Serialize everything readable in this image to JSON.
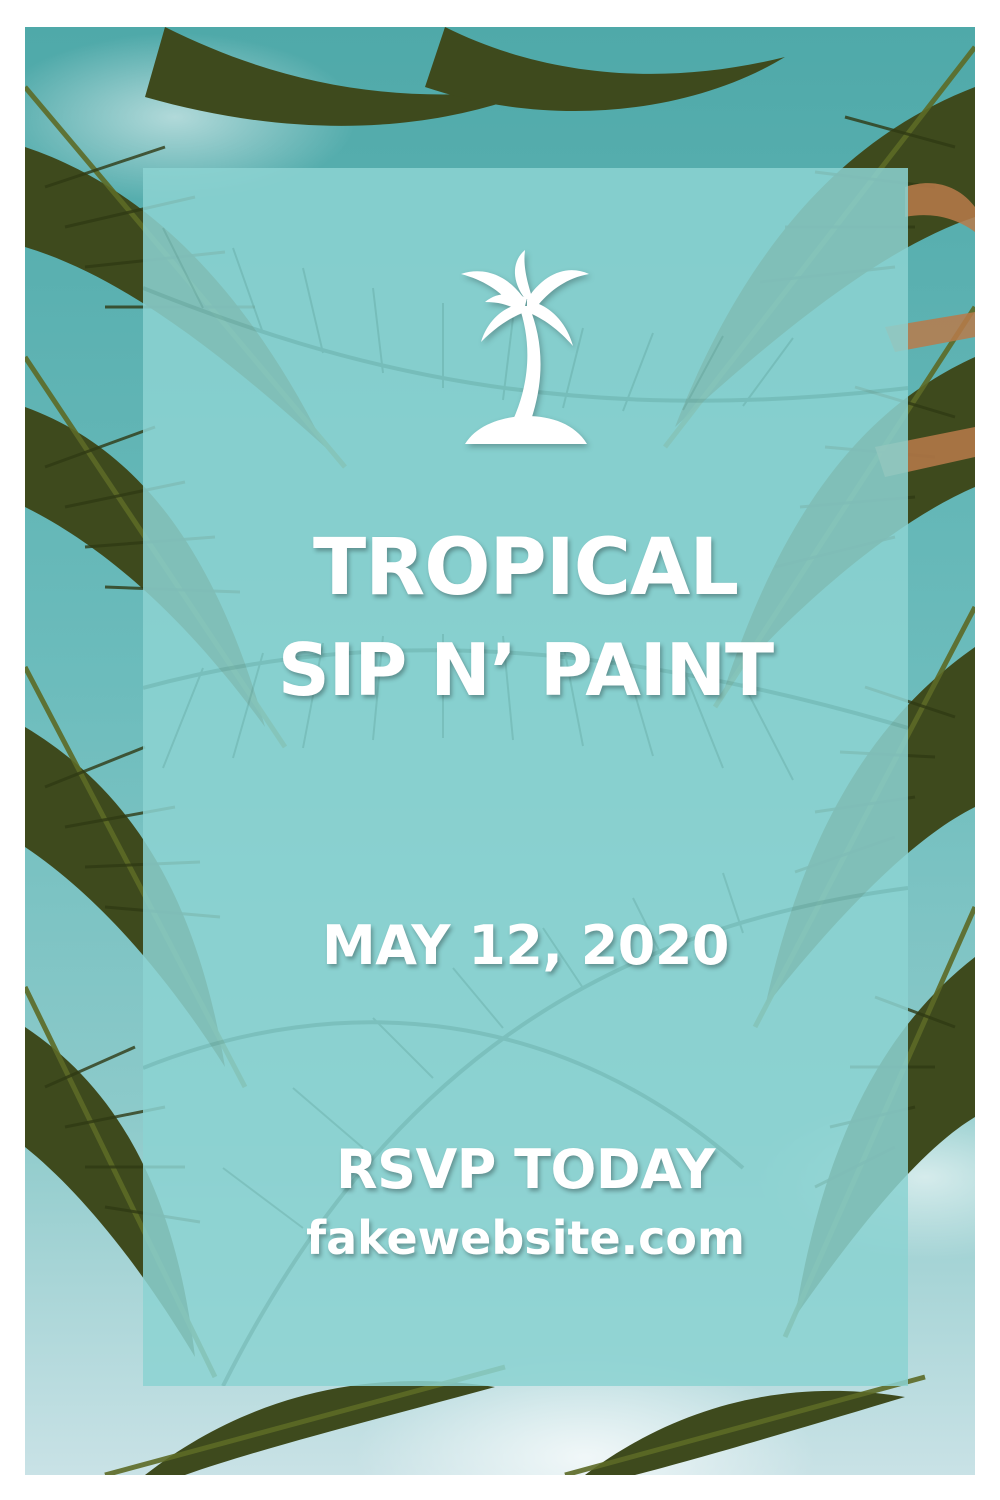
{
  "flyer": {
    "icon": "palm-tree-icon",
    "title_line1": "TROPICAL",
    "title_line2": "SIP N’ PAINT",
    "date": "MAY 12, 2020",
    "cta": "RSVP TODAY",
    "website": "fakewebsite.com"
  },
  "colors": {
    "sky": "#6cbcbc",
    "panel": "#8cd3d2",
    "frond": "#3d4a1c",
    "text": "#ffffff"
  }
}
